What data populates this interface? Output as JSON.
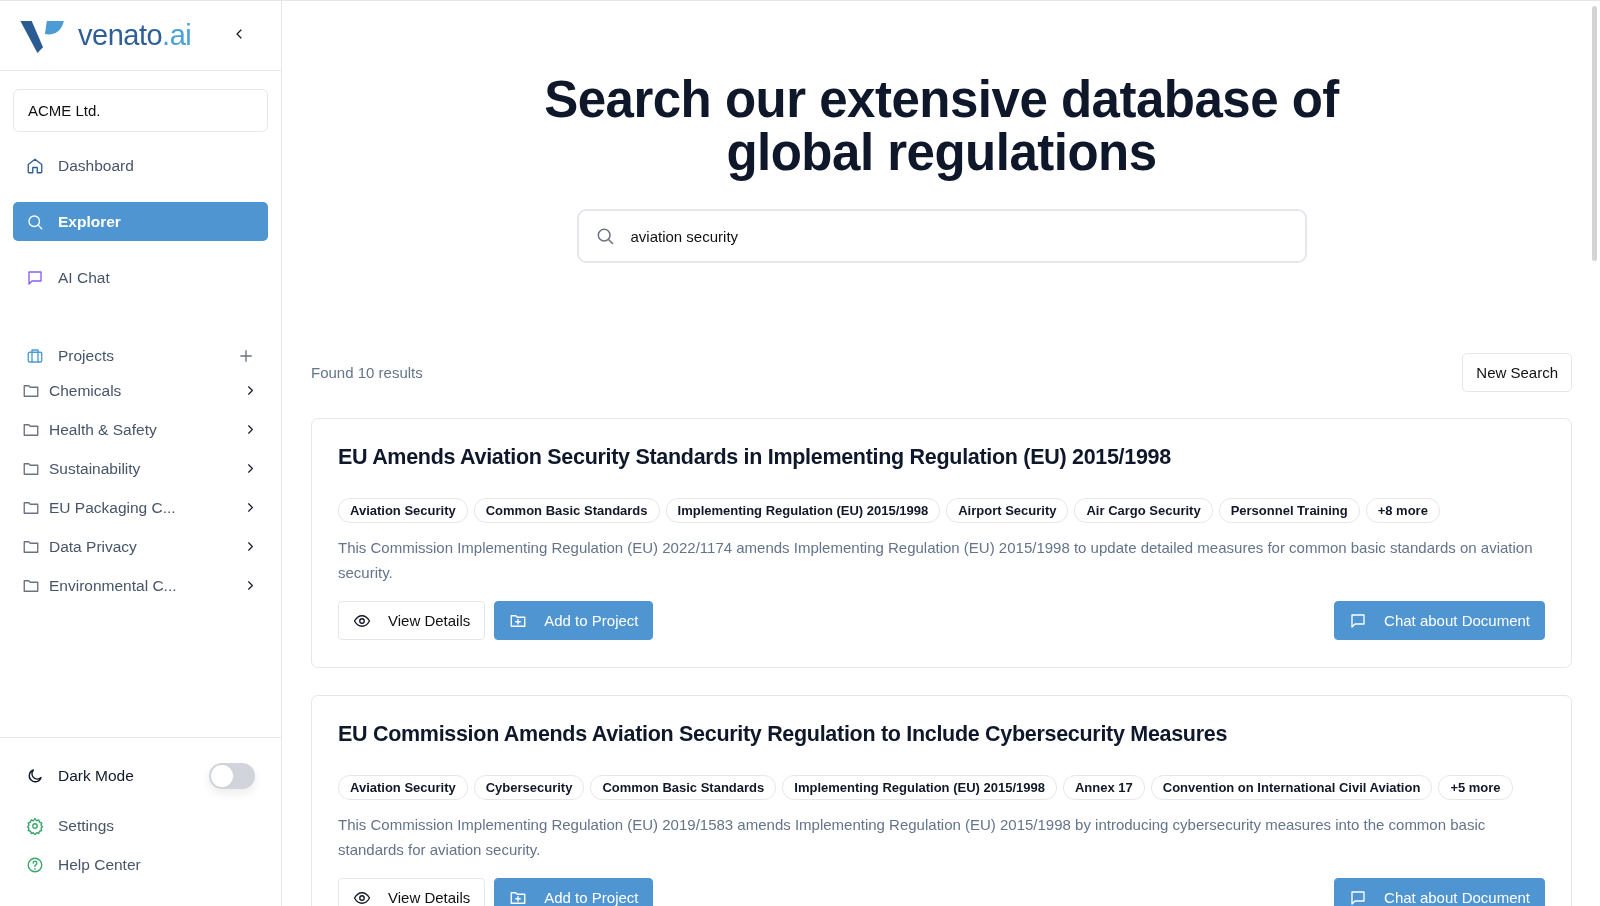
{
  "sidebar": {
    "logo": {
      "text": "venato",
      "suffix": ".ai"
    },
    "organization": {
      "value": "ACME Ltd."
    },
    "nav": [
      {
        "label": "Dashboard",
        "selected": false
      },
      {
        "label": "Explorer",
        "selected": true
      },
      {
        "label": "AI Chat",
        "selected": false
      }
    ],
    "projects": {
      "label": "Projects",
      "items": [
        {
          "label": "Chemicals"
        },
        {
          "label": "Health & Safety"
        },
        {
          "label": "Sustainability"
        },
        {
          "label": "EU Packaging C..."
        },
        {
          "label": "Data Privacy"
        },
        {
          "label": "Environmental C..."
        }
      ]
    },
    "dark_mode": {
      "label": "Dark Mode",
      "on": false
    },
    "footer": [
      {
        "label": "Settings"
      },
      {
        "label": "Help Center"
      }
    ]
  },
  "main": {
    "heading": "Search our extensive database of global regulations",
    "search": {
      "value": "aviation security"
    },
    "results_count": "Found 10 results",
    "new_search": "New Search",
    "results": [
      {
        "title": "EU Amends Aviation Security Standards in Implementing Regulation (EU) 2015/1998",
        "tags": [
          "Aviation Security",
          "Common Basic Standards",
          "Implementing Regulation (EU) 2015/1998",
          "Airport Security",
          "Air Cargo Security",
          "Personnel Training",
          "+8 more"
        ],
        "summary": "This Commission Implementing Regulation (EU) 2022/1174 amends Implementing Regulation (EU) 2015/1998 to update detailed measures for common basic standards on aviation security.",
        "actions": {
          "view": "View Details",
          "add": "Add to Project",
          "chat": "Chat about Document"
        }
      },
      {
        "title": "EU Commission Amends Aviation Security Regulation to Include Cybersecurity Measures",
        "tags": [
          "Aviation Security",
          "Cybersecurity",
          "Common Basic Standards",
          "Implementing Regulation (EU) 2015/1998",
          "Annex 17",
          "Convention on International Civil Aviation",
          "+5 more"
        ],
        "summary": "This Commission Implementing Regulation (EU) 2019/1583 amends Implementing Regulation (EU) 2015/1998 by introducing cybersecurity measures into the common basic standards for aviation security.",
        "actions": {
          "view": "View Details",
          "add": "Add to Project",
          "chat": "Chat about Document"
        }
      }
    ]
  }
}
